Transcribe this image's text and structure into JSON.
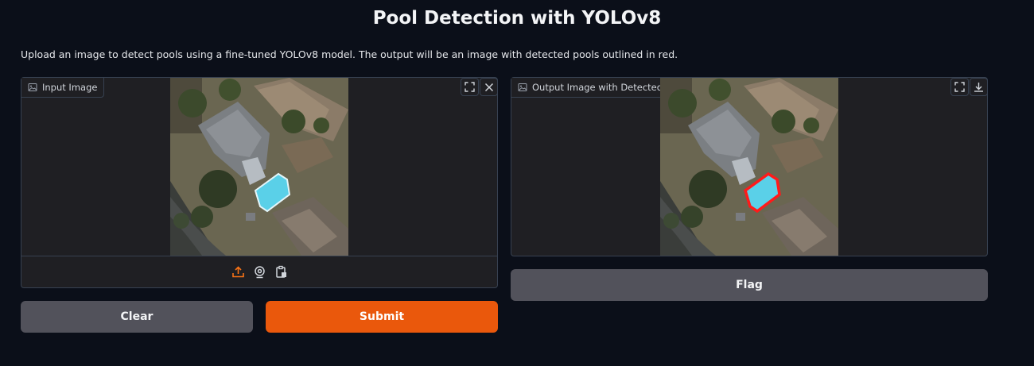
{
  "page": {
    "title": "Pool Detection with YOLOv8",
    "description": "Upload an image to detect pools using a fine-tuned YOLOv8 model. The output will be an image with detected pools outlined in red."
  },
  "input_panel": {
    "label": "Input Image",
    "icons": [
      "image-icon",
      "fullscreen-icon",
      "close-icon",
      "upload-icon",
      "webcam-icon",
      "clipboard-icon"
    ]
  },
  "output_panel": {
    "label": "Output Image with Detected Pools",
    "icons": [
      "image-icon",
      "fullscreen-icon",
      "download-icon"
    ]
  },
  "buttons": {
    "clear": "Clear",
    "submit": "Submit",
    "flag": "Flag"
  },
  "colors": {
    "background": "#0b0f19",
    "panel": "#1f1f23",
    "secondary_button": "#52525b",
    "primary_button": "#ea580c",
    "upload_accent": "#f97316",
    "detection_outline": "#ff1a1a"
  }
}
